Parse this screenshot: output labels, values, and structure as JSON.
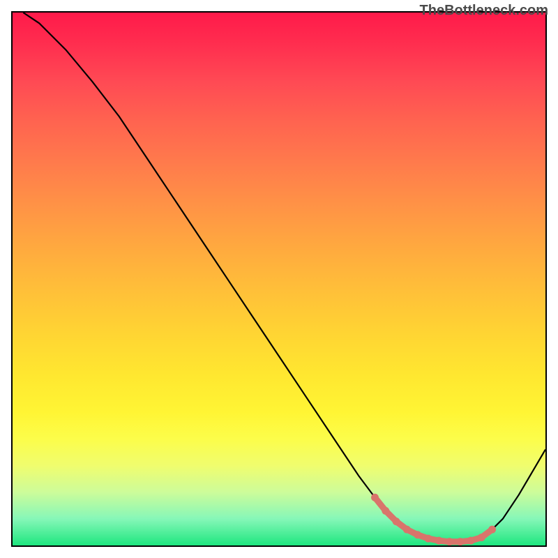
{
  "watermark": "TheBottleneck.com",
  "chart_data": {
    "type": "line",
    "title": "",
    "xlabel": "",
    "ylabel": "",
    "xlim": [
      0,
      100
    ],
    "ylim": [
      0,
      100
    ],
    "series": [
      {
        "name": "main-curve",
        "color": "#000000",
        "x": [
          2,
          5,
          10,
          15,
          20,
          25,
          30,
          35,
          40,
          45,
          50,
          55,
          60,
          65,
          68,
          70,
          72,
          74,
          76,
          78,
          80,
          82,
          84,
          86,
          88,
          90,
          92,
          95,
          100
        ],
        "y": [
          100,
          98,
          93,
          87,
          80.5,
          73,
          65.5,
          58,
          50.5,
          43,
          35.5,
          28,
          20.5,
          13,
          9,
          6.5,
          4.5,
          3,
          2,
          1.3,
          0.9,
          0.7,
          0.7,
          0.9,
          1.5,
          3,
          5,
          9.5,
          18
        ]
      },
      {
        "name": "highlight-segment",
        "color": "#d9746b",
        "style": "dotted-thick",
        "x": [
          68,
          70,
          72,
          74,
          76,
          78,
          80,
          82,
          84,
          86,
          88,
          90
        ],
        "y": [
          9,
          6.5,
          4.5,
          3,
          2,
          1.3,
          0.9,
          0.7,
          0.7,
          0.9,
          1.5,
          3
        ]
      }
    ],
    "background": {
      "type": "vertical-gradient",
      "stops": [
        {
          "pos": 0,
          "color": "#ff1a4a"
        },
        {
          "pos": 50,
          "color": "#ffbf39"
        },
        {
          "pos": 80,
          "color": "#fcfd4a"
        },
        {
          "pos": 100,
          "color": "#1ee67f"
        }
      ]
    }
  }
}
